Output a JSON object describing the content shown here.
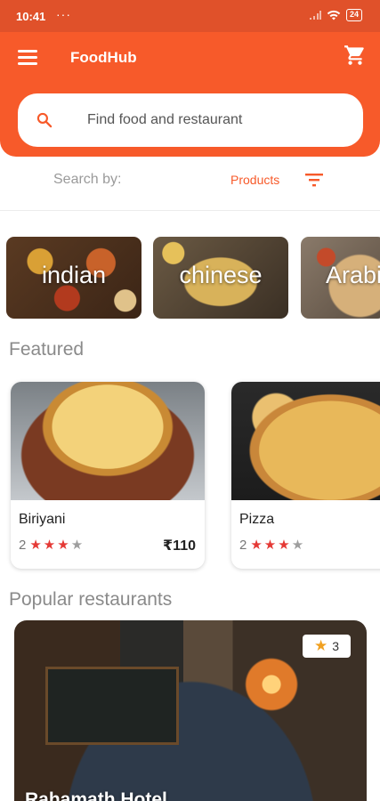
{
  "status_bar": {
    "time": "10:41",
    "dots": "···",
    "battery": "24"
  },
  "app_bar": {
    "title": "FoodHub"
  },
  "search": {
    "placeholder": "Find food and restaurant"
  },
  "filter": {
    "label": "Search by:",
    "value": "Products"
  },
  "categories": [
    {
      "label": "indian"
    },
    {
      "label": "chinese"
    },
    {
      "label": "Arabi"
    }
  ],
  "featured": {
    "title": "Featured",
    "items": [
      {
        "name": "Biriyani",
        "rating": "2",
        "stars_filled": 3,
        "stars_total": 4,
        "price": "₹110"
      },
      {
        "name": "Pizza",
        "rating": "2",
        "stars_filled": 3,
        "stars_total": 4,
        "price": ""
      }
    ]
  },
  "popular": {
    "title": "Popular restaurants",
    "items": [
      {
        "name": "Rahamath Hotel",
        "rating": "3"
      }
    ]
  },
  "colors": {
    "accent": "#f75a2a",
    "status_bar": "#e0512a",
    "star": "#e53935",
    "star_empty": "#9e9e9e",
    "badge_star": "#f0a020"
  },
  "icons": {
    "menu": "menu-icon",
    "cart": "cart-icon",
    "search": "search-icon",
    "filter": "filter-icon",
    "star": "star-icon"
  }
}
